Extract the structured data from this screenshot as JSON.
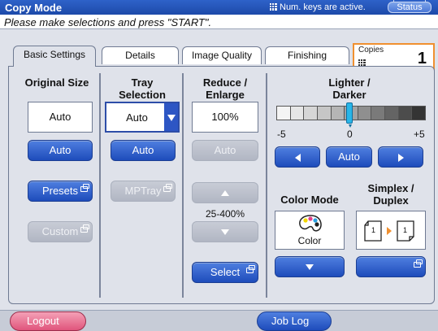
{
  "titlebar": {
    "title": "Copy Mode",
    "numkeys_text": "Num. keys are active.",
    "status_label": "Status"
  },
  "message": "Please make selections and press \"START\".",
  "tabs": [
    {
      "label": "Basic Settings",
      "active": true
    },
    {
      "label": "Details"
    },
    {
      "label": "Image Quality"
    },
    {
      "label": "Finishing"
    }
  ],
  "copies": {
    "label": "Copies",
    "value": "1"
  },
  "original_size": {
    "header_line1": "Original Size",
    "value": "Auto",
    "auto_label": "Auto",
    "presets_label": "Presets",
    "custom_label": "Custom"
  },
  "tray": {
    "header_line1": "Tray",
    "header_line2": "Selection",
    "value": "Auto",
    "auto_label": "Auto",
    "mptray_label": "MPTray"
  },
  "reduce": {
    "header_line1": "Reduce /",
    "header_line2": "Enlarge",
    "value": "100%",
    "auto_label": "Auto",
    "range_label": "25-400%",
    "select_label": "Select"
  },
  "density": {
    "header_line1": "Lighter /",
    "header_line2": "Darker",
    "min_label": "-5",
    "mid_label": "0",
    "max_label": "+5",
    "auto_label": "Auto",
    "level": 0
  },
  "color_mode": {
    "header": "Color Mode",
    "value": "Color"
  },
  "simplex": {
    "header_line1": "Simplex /",
    "header_line2": "Duplex",
    "left_page": "1",
    "right_page": "1"
  },
  "bottom": {
    "logout_label": "Logout",
    "joblog_label": "Job Log"
  },
  "colors": {
    "accent": "#1e4cbb",
    "copies_border": "#f09030",
    "logout": "#e0557c"
  }
}
